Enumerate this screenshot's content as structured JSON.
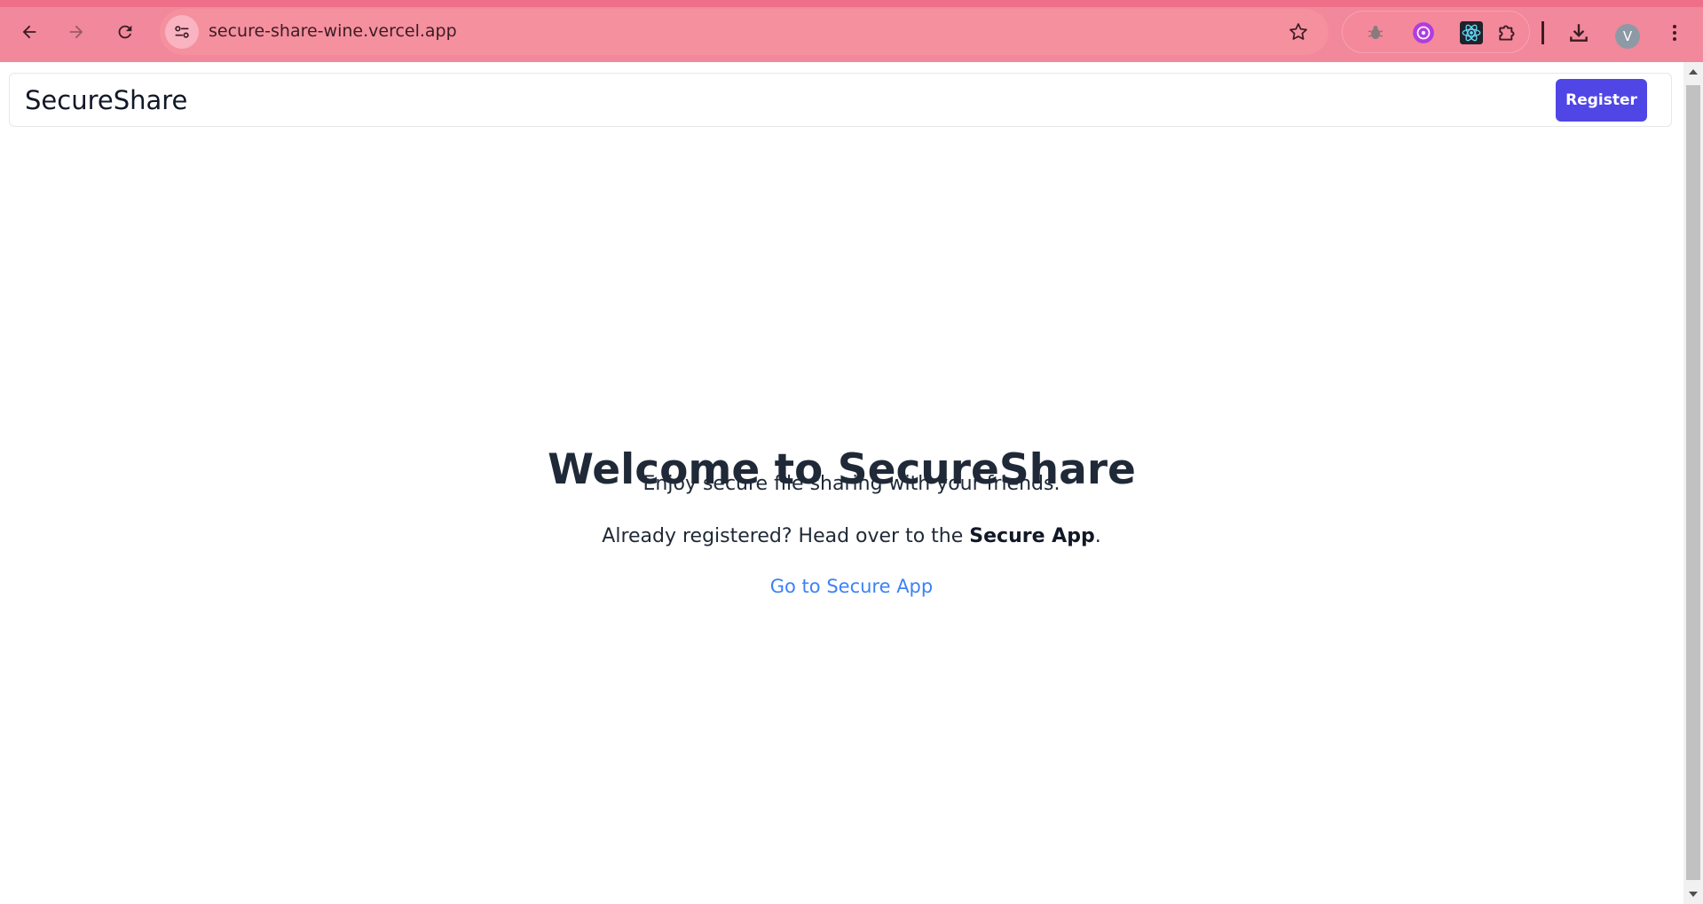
{
  "browser": {
    "url": "secure-share-wine.vercel.app",
    "profile_initial": "V",
    "theme_color": "#f2889b",
    "icons": {
      "back": "back-arrow-icon",
      "forward": "forward-arrow-icon",
      "reload": "reload-icon",
      "site_info": "tune-icon",
      "bookmark": "star-icon",
      "extensions": [
        "bug-extension-icon",
        "purple-extension-icon",
        "react-devtools-icon",
        "puzzle-extensions-icon"
      ],
      "download": "download-icon",
      "menu": "kebab-menu-icon"
    }
  },
  "header": {
    "brand": "SecureShare",
    "register_label": "Register",
    "register_color": "#4f46e5"
  },
  "main": {
    "title": "Welcome to SecureShare",
    "tagline": "Enjoy secure file sharing with your friends.",
    "already_prefix": "Already registered? Head over to the ",
    "already_bold": "Secure App",
    "already_suffix": ".",
    "link_label": "Go to Secure App",
    "link_color": "#3b82f6"
  }
}
